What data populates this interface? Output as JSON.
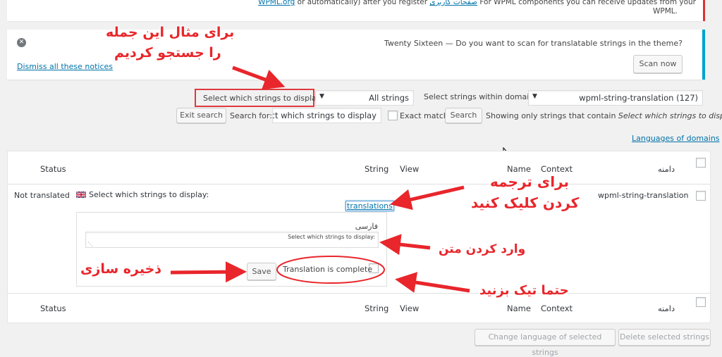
{
  "top_notice": {
    "line1_prefix": "WPML.org",
    "line1_text": "or automatically) after you register",
    "line1_link2": "صفحات کاربری",
    "line1_rest": "For WPML components you can receive updates from your",
    "line2": "WPML."
  },
  "scan_notice": {
    "question": "Twenty Sixteen — Do you want to scan for translatable strings in the theme?",
    "scan_button": "Scan now",
    "dismiss_all": "Dismiss all these notices"
  },
  "filters": {
    "strings_label": "Select which strings to display:",
    "strings_value": "All strings",
    "domain_label": "Select strings within domain:",
    "domain_value": "wpml-string-translation (127)",
    "exit_search": "Exit search",
    "search_for_label": "Search for:",
    "search_value": "ect which strings to display",
    "exact_match": "Exact match",
    "search_button": "Search",
    "showing_prefix": "Showing only strings that contain",
    "showing_term": "Select which strings to display",
    "languages_of_domains": "Languages of domains"
  },
  "table": {
    "headers": {
      "domain": "دامنه",
      "context": "Context",
      "name": "Name",
      "view": "View",
      "string": "String",
      "status": "Status"
    },
    "row": {
      "domain": "wpml-string-translation",
      "string": "Select which strings to display:",
      "translations_link": "translations",
      "status": "Not translated"
    },
    "editor": {
      "language": "فارسی",
      "textarea_value": "Select which strings to display:",
      "complete_label": "Translation is complete",
      "save_button": "Save"
    }
  },
  "bulk": {
    "change_language": "Change language of selected strings",
    "delete_selected": "Delete selected strings"
  },
  "annotations": {
    "searched_line1": "برای مثال این جمله",
    "searched_line2": "را جستجو کردیم",
    "click_line1": "برای ترجمه",
    "click_line2": "کردن کلیک کنید",
    "enter_text": "وارد کردن متن",
    "save": "ذخیره سازی",
    "tick": "حتما تیک بزنید"
  },
  "colors": {
    "accent_red": "#e8262b",
    "link_blue": "#0073aa",
    "notice_blue": "#00a0d2"
  }
}
